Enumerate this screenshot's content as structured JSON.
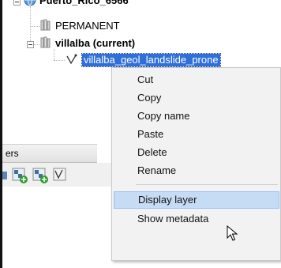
{
  "tree": {
    "location": "Puerto_Rico_6566",
    "mapsets": [
      {
        "label": "PERMANENT",
        "current": false
      },
      {
        "label": "villalba  (current)",
        "current": true
      }
    ],
    "selected_layer": "villalba_geol_landslide_prone"
  },
  "layers_panel": {
    "tab_label": "ers"
  },
  "context_menu": {
    "items": [
      {
        "label": "Cut"
      },
      {
        "label": "Copy"
      },
      {
        "label": "Copy name"
      },
      {
        "label": "Paste"
      },
      {
        "label": "Delete"
      },
      {
        "label": "Rename"
      },
      {
        "label": "Display layer",
        "highlighted": true
      },
      {
        "label": "Show metadata"
      }
    ]
  },
  "colors": {
    "selection": "#2f6fd8",
    "menu_highlight": "#c6dcf5",
    "menu_background": "#f2f2f2"
  },
  "icons": [
    "globe-icon",
    "mapset-icon",
    "vector-icon",
    "add-raster-icon",
    "add-vector-icon",
    "mouse-pointer-icon"
  ]
}
